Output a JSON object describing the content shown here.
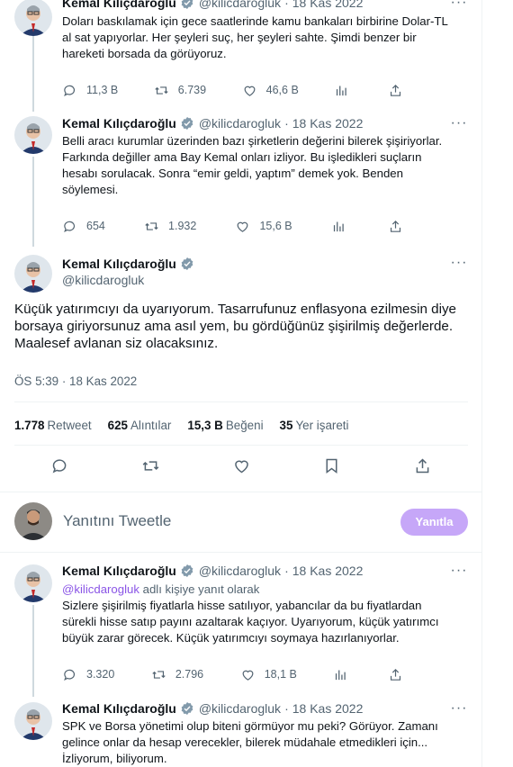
{
  "author": {
    "name": "Kemal Kılıçdaroğlu",
    "handle": "@kilicdarogluk"
  },
  "tweets": [
    {
      "date": "18 Kas 2022",
      "text": "Doları baskılamak için gece saatlerinde kamu bankaları birbirine Dolar-TL al sat yapıyorlar. Her şeyleri suç, her şeyleri sahte. Şimdi benzer bir hareketi borsada da görüyoruz.",
      "replies": "11,3 B",
      "retweets": "6.739",
      "likes": "46,6 B"
    },
    {
      "date": "18 Kas 2022",
      "text": "Belli aracı kurumlar üzerinden bazı şirketlerin değerini bilerek şişiriyorlar. Farkında değiller ama Bay Kemal onları izliyor. Bu işledikleri suçların hesabı sorulacak. Sonra “emir geldi, yaptım” demek yok. Benden söylemesi.",
      "replies": "654",
      "retweets": "1.932",
      "likes": "15,6 B"
    }
  ],
  "main_tweet": {
    "text": "Küçük yatırımcıyı da uyarıyorum. Tasarrufunuz enflasyona ezilmesin diye borsaya giriyorsunuz ama asıl yem, bu gördüğünüz şişirilmiş değerlerde. Maalesef avlanan siz olacaksınız.",
    "timestamp": "ÖS 5:39 · 18 Kas 2022",
    "stats": [
      {
        "value": "1.778",
        "label": "Retweet"
      },
      {
        "value": "625",
        "label": "Alıntılar"
      },
      {
        "value": "15,3 B",
        "label": "Beğeni"
      },
      {
        "value": "35",
        "label": "Yer işareti"
      }
    ]
  },
  "reply_box": {
    "placeholder": "Yanıtını Tweetle",
    "button": "Yanıtla"
  },
  "replies": [
    {
      "date": "18 Kas 2022",
      "reply_to_mention": "@kilicdarogluk",
      "reply_to_suffix": " adlı kişiye yanıt olarak",
      "text": "Sizlere şişirilmiş fiyatlarla hisse satılıyor, yabancılar da bu fiyatlardan sürekli hisse satıp payını azaltarak kaçıyor. Uyarıyorum, küçük yatırımcı büyük zarar görecek. Küçük yatırımcıyı soymaya hazırlanıyorlar.",
      "replies": "3.320",
      "retweets": "2.796",
      "likes": "18,1 B"
    },
    {
      "date": "18 Kas 2022",
      "text": "SPK ve Borsa yönetimi olup biteni görmüyor mu peki? Görüyor. Zamanı gelince onlar da hesap verecekler, bilerek müdahale etmedikleri için... İzliyorum, biliyorum."
    }
  ],
  "colors": {
    "accent": "#1d9bf0",
    "reply_button": "#c6a7f8",
    "mention": "#8a55e6",
    "secondary_text": "#536471"
  }
}
